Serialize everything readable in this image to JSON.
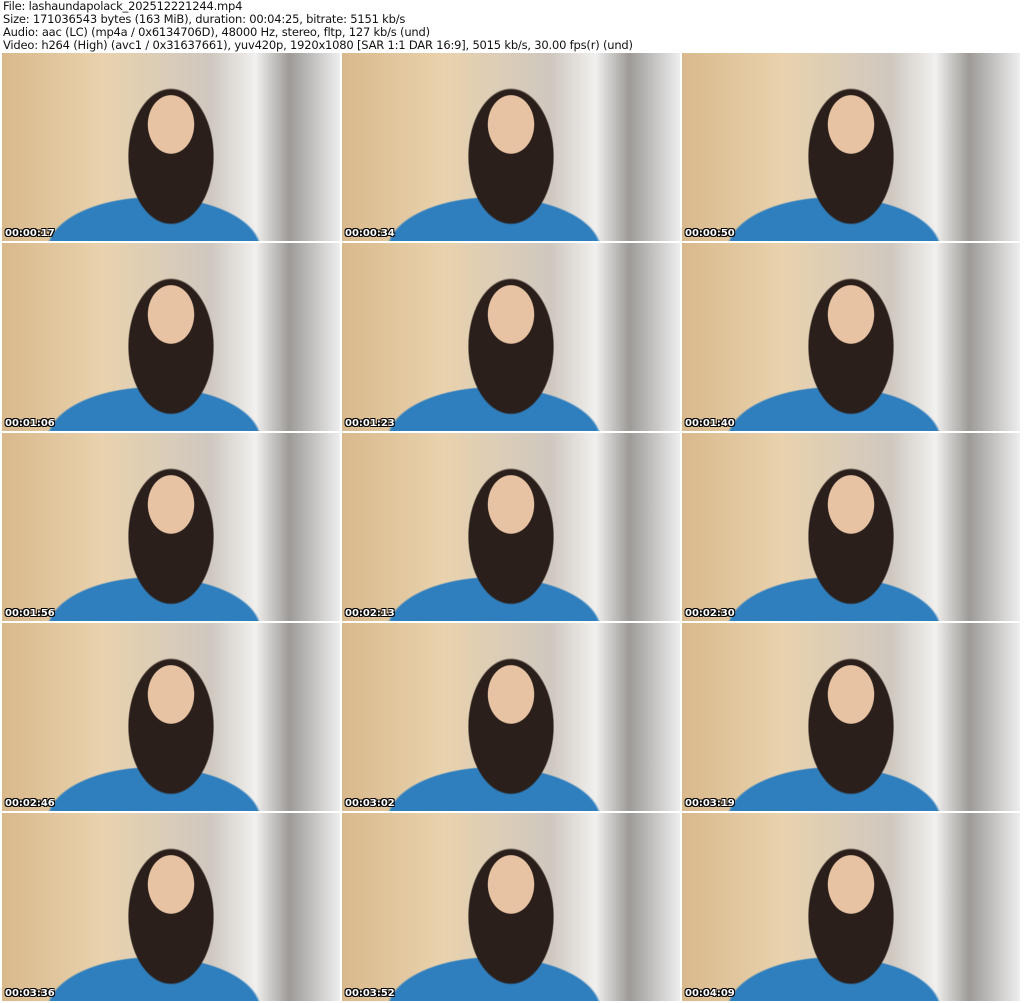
{
  "header": {
    "file": "File: lashaundapolack_202512221244.mp4",
    "size": "Size: 171036543 bytes (163 MiB), duration: 00:04:25, bitrate: 5151 kb/s",
    "audio": "Audio: aac (LC) (mp4a / 0x6134706D), 48000 Hz, stereo, fltp, 127 kb/s (und)",
    "video": "Video: h264 (High) (avc1 / 0x31637661), yuv420p, 1920x1080 [SAR 1:1 DAR 16:9], 5015 kb/s, 30.00 fps(r) (und)"
  },
  "thumbnails": [
    {
      "time": "00:00:17"
    },
    {
      "time": "00:00:34"
    },
    {
      "time": "00:00:50"
    },
    {
      "time": "00:01:06"
    },
    {
      "time": "00:01:23"
    },
    {
      "time": "00:01:40"
    },
    {
      "time": "00:01:56"
    },
    {
      "time": "00:02:13"
    },
    {
      "time": "00:02:30"
    },
    {
      "time": "00:02:46"
    },
    {
      "time": "00:03:02"
    },
    {
      "time": "00:03:19"
    },
    {
      "time": "00:03:36"
    },
    {
      "time": "00:03:52"
    },
    {
      "time": "00:04:09"
    }
  ]
}
